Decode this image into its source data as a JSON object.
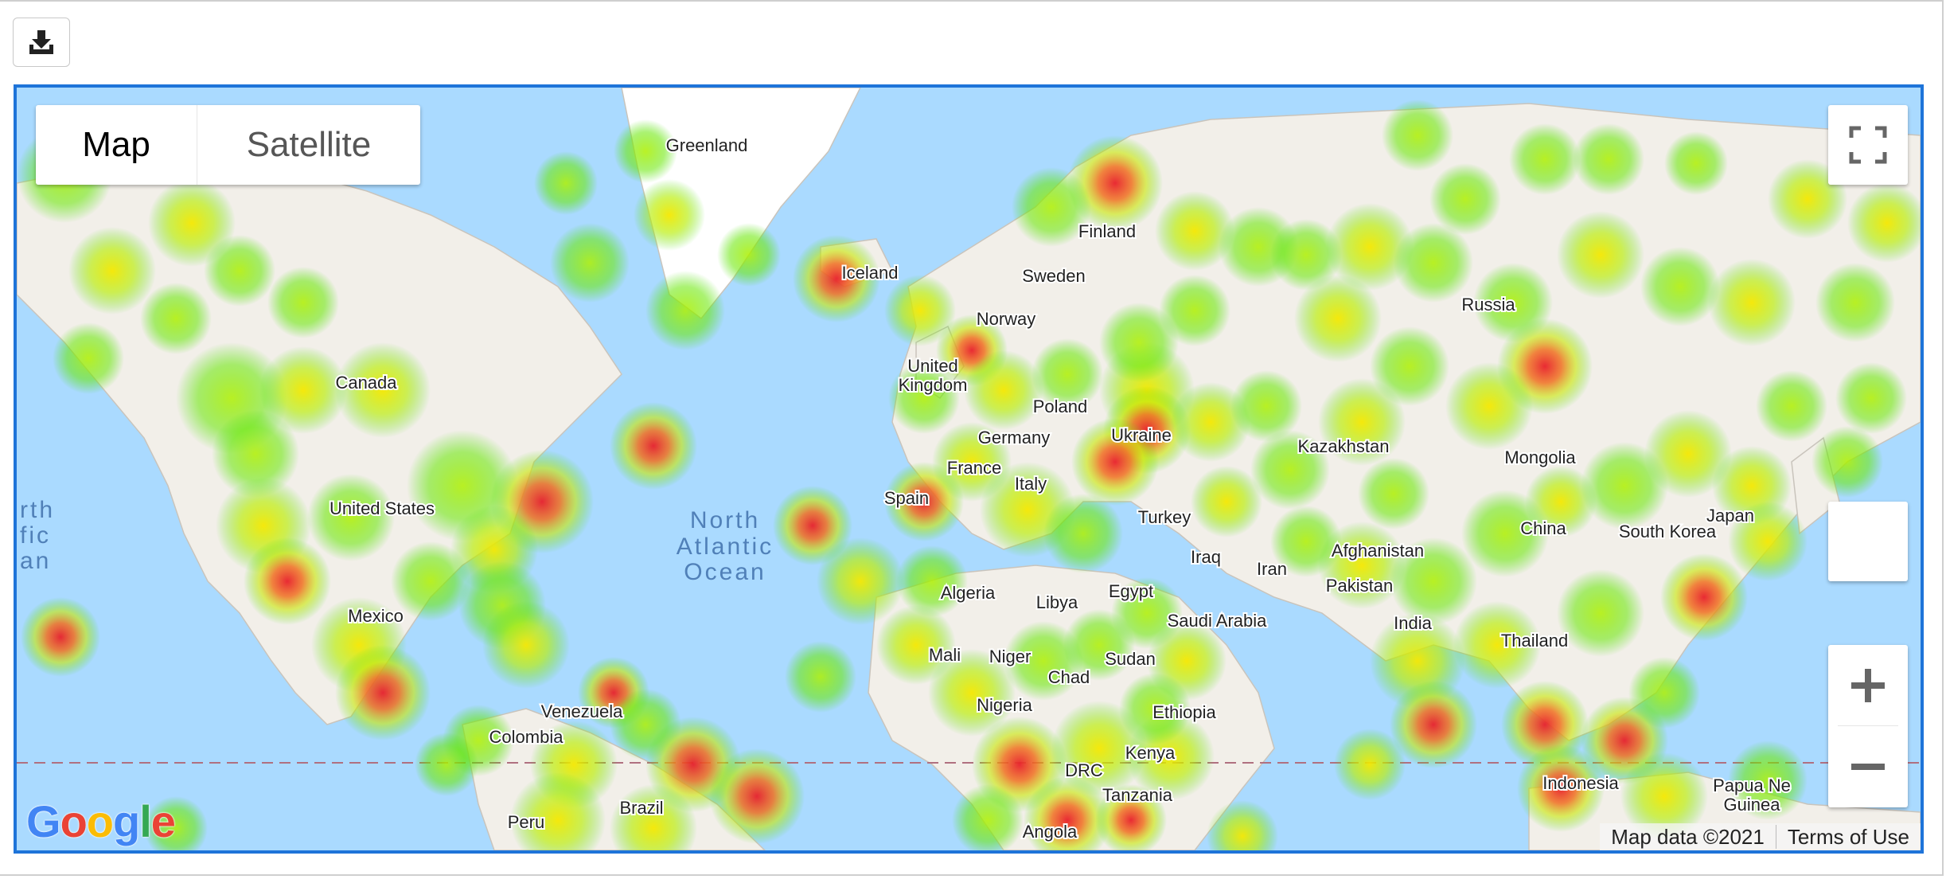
{
  "map_type_control": {
    "map_label": "Map",
    "satellite_label": "Satellite",
    "selected": "Map"
  },
  "labels": {
    "greenland": "Greenland",
    "iceland": "Iceland",
    "finland": "Finland",
    "sweden": "Sweden",
    "norway": "Norway",
    "united_kingdom_1": "United",
    "united_kingdom_2": "Kingdom",
    "poland": "Poland",
    "germany": "Germany",
    "ukraine": "Ukraine",
    "france": "France",
    "italy": "Italy",
    "spain": "Spain",
    "turkey": "Turkey",
    "iraq": "Iraq",
    "iran": "Iran",
    "afghanistan": "Afghanistan",
    "pakistan": "Pakistan",
    "kazakhstan": "Kazakhstan",
    "russia": "Russia",
    "mongolia": "Mongolia",
    "china": "China",
    "south_korea": "South Korea",
    "japan": "Japan",
    "india": "India",
    "thailand": "Thailand",
    "indonesia": "Indonesia",
    "papua_1": "Papua Ne",
    "papua_2": "Guinea",
    "canada": "Canada",
    "united_states": "United States",
    "mexico": "Mexico",
    "venezuela": "Venezuela",
    "colombia": "Colombia",
    "peru": "Peru",
    "brazil": "Brazil",
    "algeria": "Algeria",
    "libya": "Libya",
    "egypt": "Egypt",
    "saudi_arabia": "Saudi Arabia",
    "mali": "Mali",
    "niger": "Niger",
    "chad": "Chad",
    "sudan": "Sudan",
    "nigeria": "Nigeria",
    "ethiopia": "Ethiopia",
    "kenya": "Kenya",
    "drc": "DRC",
    "tanzania": "Tanzania",
    "angola": "Angola",
    "north_atlantic_1": "North",
    "north_atlantic_2": "Atlantic",
    "north_atlantic_3": "Ocean",
    "pacific_1": "rth",
    "pacific_2": "fic",
    "pacific_3": "an"
  },
  "attribution": {
    "map_data": "Map data ©2021",
    "terms": "Terms of Use"
  },
  "logo": {
    "letters": [
      "G",
      "o",
      "o",
      "g",
      "l",
      "e"
    ],
    "colors": [
      "#4285f4",
      "#ea4335",
      "#fbbc05",
      "#4285f4",
      "#34a853",
      "#ea4335"
    ]
  },
  "colors": {
    "ocean": "#aadaff",
    "land": "#f2efe9",
    "border": "#1e74d9",
    "heat_low": "#7cf000",
    "heat_mid": "#fff000",
    "heat_high": "#ff3030"
  },
  "icons": {
    "download": "download-icon",
    "fullscreen": "fullscreen-icon",
    "zoom_in": "plus-icon",
    "zoom_out": "minus-icon"
  }
}
